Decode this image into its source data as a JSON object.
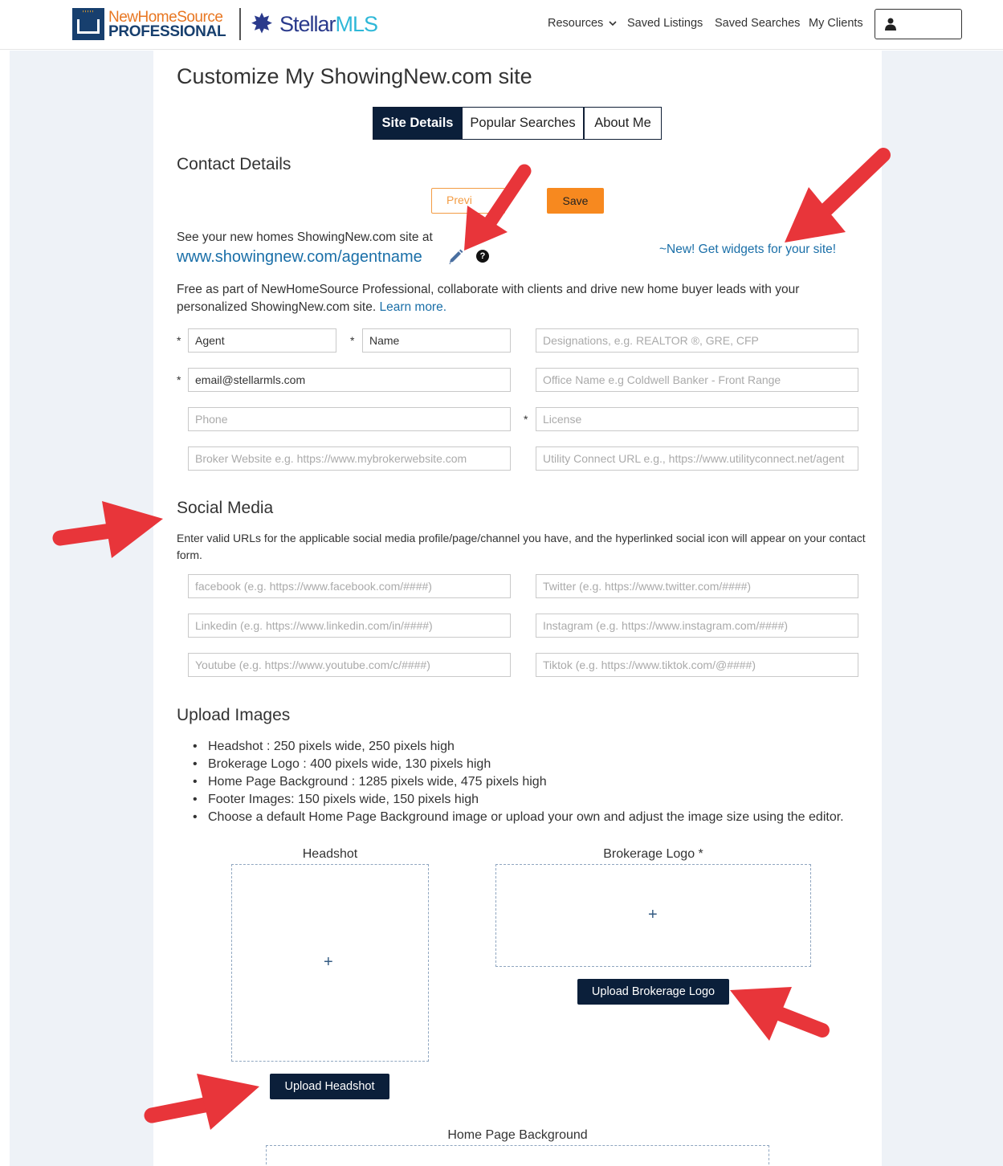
{
  "header": {
    "logo_nhs_line1": "NewHomeSource",
    "logo_nhs_line2": "PROFESSIONAL",
    "logo_stellar": "Stellar",
    "logo_stellar_suffix": "MLS",
    "nav": {
      "resources": "Resources",
      "saved_listings": "Saved Listings",
      "saved_searches": "Saved Searches",
      "my_clients": "My Clients"
    }
  },
  "page": {
    "title": "Customize My ShowingNew.com site",
    "tabs": [
      "Site Details",
      "Popular Searches",
      "About Me"
    ],
    "active_tab": "Site Details"
  },
  "contact": {
    "heading": "Contact Details",
    "preview_label": "Previ",
    "save_label": "Save",
    "see_text": "See your new homes ShowingNew.com site at",
    "site_link": "www.showingnew.com/agentname",
    "help_glyph": "?",
    "widgets_link": "~New! Get widgets for your site!",
    "free_text": "Free as part of NewHomeSource Professional, collaborate with clients and drive new home buyer leads with your personalized ShowingNew.com site.",
    "learn_more": "Learn more.",
    "required_marker": "*",
    "fields": {
      "first_name": "Agent",
      "last_name": "Name",
      "designations_placeholder": "Designations, e.g. REALTOR ®, GRE, CFP",
      "email": "email@stellarmls.com",
      "office_placeholder": "Office Name e.g Coldwell Banker - Front Range",
      "phone_placeholder": "Phone",
      "license_placeholder": "License",
      "broker_placeholder": "Broker Website e.g. https://www.mybrokerwebsite.com",
      "utility_placeholder": "Utility Connect URL e.g., https://www.utilityconnect.net/agent"
    }
  },
  "social": {
    "heading": "Social Media",
    "text": "Enter valid URLs for the applicable social media profile/page/channel you have, and the hyperlinked social icon will appear on your contact form.",
    "fields": {
      "facebook": "facebook (e.g. https://www.facebook.com/####)",
      "twitter": "Twitter (e.g. https://www.twitter.com/####)",
      "linkedin": "Linkedin (e.g. https://www.linkedin.com/in/####)",
      "instagram": "Instagram (e.g. https://www.instagram.com/####)",
      "youtube": "Youtube (e.g. https://www.youtube.com/c/####)",
      "tiktok": "Tiktok (e.g. https://www.tiktok.com/@####)"
    }
  },
  "upload": {
    "heading": "Upload Images",
    "specs": [
      "Headshot : 250 pixels wide, 250 pixels high",
      "Brokerage Logo : 400 pixels wide, 130 pixels high",
      "Home Page Background : 1285 pixels wide, 475 pixels high",
      "Footer Images: 150 pixels wide, 150 pixels high",
      "Choose a default Home Page Background image or upload your own and adjust the image size using the editor."
    ],
    "headshot_label": "Headshot",
    "logo_label": "Brokerage Logo *",
    "background_label": "Home Page Background",
    "plus_glyph": "+",
    "upload_logo_button": "Upload Brokerage Logo",
    "upload_headshot_button": "Upload Headshot"
  },
  "colors": {
    "navy": "#0b1f3a",
    "orange": "#f7891f",
    "link_blue": "#1a6fa8",
    "annotation_red": "#e8353a",
    "page_bg": "#eef2f7"
  }
}
